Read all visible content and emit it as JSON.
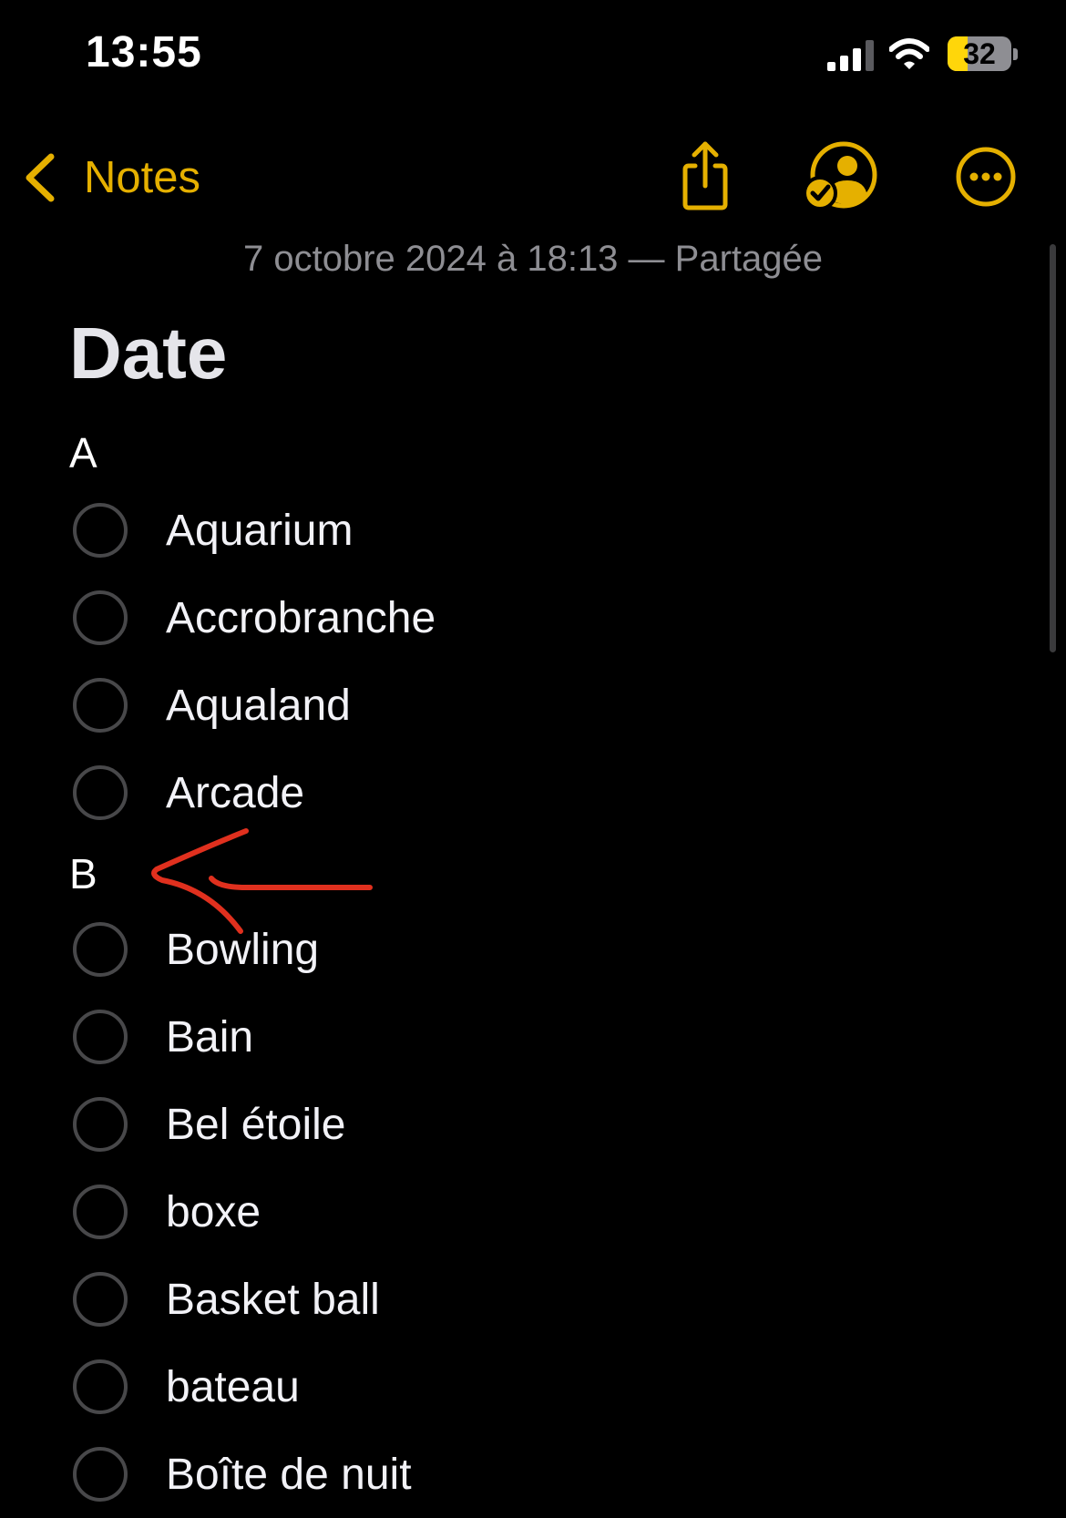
{
  "status_bar": {
    "time": "13:55",
    "battery_level": "32",
    "battery_fraction": 0.32,
    "battery_charging": true,
    "icons": [
      "signal-bars-icon",
      "wifi-icon",
      "battery-icon"
    ]
  },
  "nav": {
    "back_label": "Notes",
    "icons": [
      "chevron-left-icon",
      "share-icon",
      "collaborate-icon",
      "more-icon"
    ]
  },
  "note": {
    "meta": "7 octobre 2024 à 18:13 — Partagée",
    "title": "Date",
    "sections": [
      {
        "heading": "A",
        "items": [
          {
            "label": "Aquarium",
            "checked": false
          },
          {
            "label": "Accrobranche",
            "checked": false
          },
          {
            "label": "Aqualand",
            "checked": false
          },
          {
            "label": "Arcade",
            "checked": false
          }
        ]
      },
      {
        "heading": "B",
        "items": [
          {
            "label": "Bowling",
            "checked": false
          },
          {
            "label": "Bain",
            "checked": false
          },
          {
            "label": "Bel étoile",
            "checked": false
          },
          {
            "label": "boxe",
            "checked": false
          },
          {
            "label": "Basket ball",
            "checked": false
          },
          {
            "label": "bateau",
            "checked": false
          },
          {
            "label": "Boîte de nuit",
            "checked": false
          }
        ]
      }
    ]
  },
  "colors": {
    "background": "#000000",
    "accent": "#e5b000",
    "meta_text": "#8e8e93",
    "annotation": "#e0301e"
  }
}
